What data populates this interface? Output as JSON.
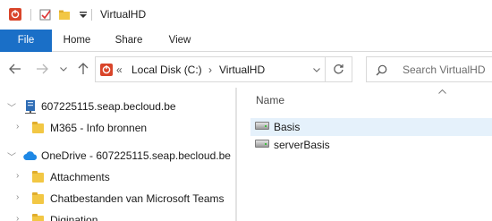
{
  "window": {
    "title": "VirtualHD"
  },
  "ribbon": {
    "tabs": [
      {
        "label": "File",
        "active": true
      },
      {
        "label": "Home"
      },
      {
        "label": "Share"
      },
      {
        "label": "View"
      }
    ]
  },
  "navigation": {
    "back_icon": "arrow-left-icon",
    "forward_icon": "arrow-right-icon",
    "recent_icon": "chevron-down-icon",
    "up_icon": "arrow-up-icon"
  },
  "address": {
    "overflow": "«",
    "crumbs": [
      "Local Disk (C:)",
      "VirtualHD"
    ],
    "separator": "›",
    "dropdown_icon": "chevron-down-icon",
    "refresh_icon": "refresh-icon"
  },
  "search": {
    "placeholder": "Search VirtualHD"
  },
  "tree": {
    "items": [
      {
        "label": "607225115.seap.becloud.be",
        "icon": "network-drive-icon"
      },
      {
        "label": "M365 - Info bronnen",
        "icon": "folder-icon"
      },
      {
        "label": "OneDrive - 607225115.seap.becloud.be",
        "icon": "cloud-icon"
      },
      {
        "label": "Attachments",
        "icon": "folder-icon"
      },
      {
        "label": "Chatbestanden van Microsoft Teams",
        "icon": "folder-icon"
      },
      {
        "label": "Digination",
        "icon": "folder-icon"
      }
    ]
  },
  "content": {
    "column_header": "Name",
    "files": [
      {
        "name": "Basis",
        "icon": "drive-icon",
        "selected": true
      },
      {
        "name": "serverBasis",
        "icon": "drive-icon",
        "selected": false
      }
    ]
  },
  "colors": {
    "accent": "#1a6fc7",
    "folder": "#f2c744",
    "selection": "#e5f1fb",
    "onedrive": "#1e88e5"
  }
}
